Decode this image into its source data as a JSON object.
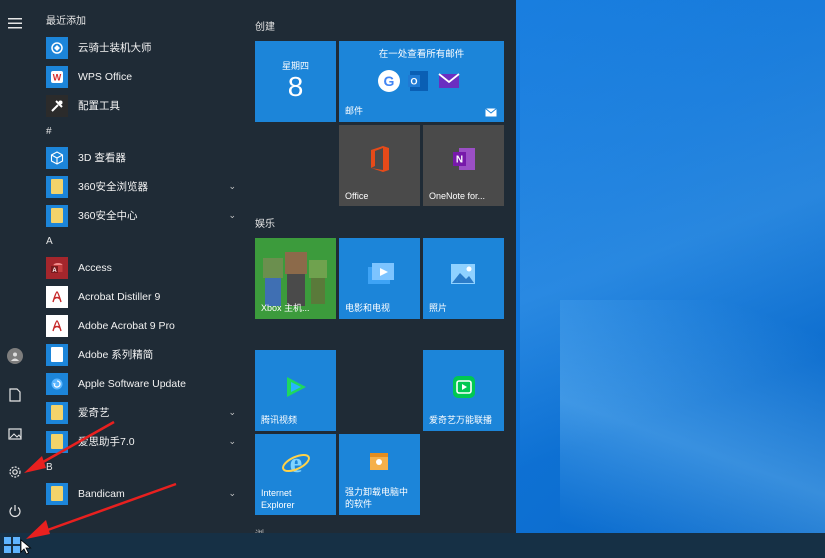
{
  "start_menu": {
    "recent_header": "最近添加",
    "apps": [
      {
        "label": "云骑士装机大师",
        "icon": "cloud-rider-icon",
        "color": "#1c85d9"
      },
      {
        "label": "WPS Office",
        "icon": "wps-icon",
        "color": "#d62b2b"
      },
      {
        "label": "配置工具",
        "icon": "tools-icon",
        "color": "#333333"
      },
      {
        "group": "#"
      },
      {
        "label": "3D 查看器",
        "icon": "3d-viewer-icon",
        "color": "#1c85d9"
      },
      {
        "label": "360安全浏览器",
        "icon": "folder-icon",
        "color": "#1c85d9",
        "expand": true
      },
      {
        "label": "360安全中心",
        "icon": "folder-icon",
        "color": "#1c85d9",
        "expand": true
      },
      {
        "group": "A"
      },
      {
        "label": "Access",
        "icon": "access-icon",
        "color": "#a4262c"
      },
      {
        "label": "Acrobat Distiller 9",
        "icon": "acrobat-distiller-icon",
        "color": "#ffffff"
      },
      {
        "label": "Adobe Acrobat 9 Pro",
        "icon": "acrobat-icon",
        "color": "#ffffff"
      },
      {
        "label": "Adobe 系列精简",
        "icon": "folder-icon",
        "color": "#1c85d9"
      },
      {
        "label": "Apple Software Update",
        "icon": "apple-update-icon",
        "color": "#1c85d9"
      },
      {
        "label": "爱奇艺",
        "icon": "folder-icon",
        "color": "#1c85d9",
        "expand": true
      },
      {
        "label": "爱思助手7.0",
        "icon": "folder-icon",
        "color": "#1c85d9",
        "expand": true
      },
      {
        "group": "B"
      },
      {
        "label": "Bandicam",
        "icon": "folder-icon",
        "color": "#1c85d9",
        "expand": true
      }
    ]
  },
  "tiles": {
    "create_title": "创建",
    "play_title": "娱乐",
    "calendar_day": "星期四",
    "calendar_date": "8",
    "mail_title": "在一处查看所有邮件",
    "mail_label": "邮件",
    "office_label": "Office",
    "onenote_label": "OneNote for...",
    "xbox_label": "Xbox 主机...",
    "movies_label": "电影和电视",
    "photos_label": "照片",
    "tencent_label": "腾讯视频",
    "iqiyi_label": "爱奇艺万能联播",
    "ie_label_1": "Internet",
    "ie_label_2": "Explorer",
    "uninstall_label_1": "强力卸载电脑中",
    "uninstall_label_2": "的软件",
    "bottom_partial": "浏"
  },
  "colors": {
    "tile_blue": "#1c85d9",
    "menu_bg": "#1f2b36",
    "annotation_red": "#e8201f"
  }
}
